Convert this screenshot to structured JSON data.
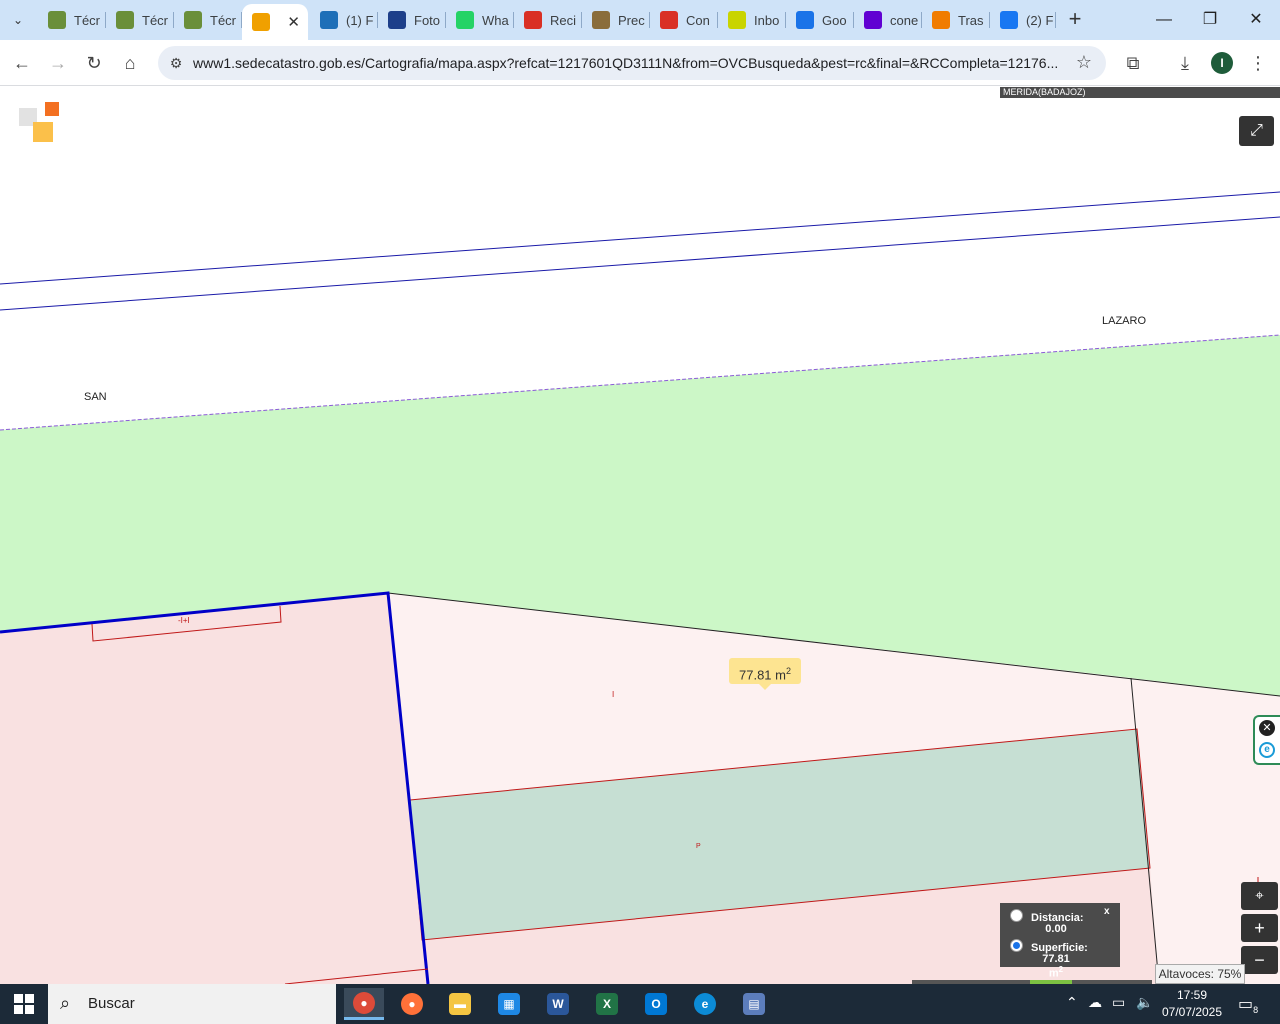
{
  "browser": {
    "tabs": [
      {
        "label": "Técr",
        "icon": "catastro-tab-icon",
        "color": "#6a8f3a"
      },
      {
        "label": "Técr",
        "icon": "catastro-tab-icon",
        "color": "#6a8f3a"
      },
      {
        "label": "Técr",
        "icon": "catastro-tab-icon",
        "color": "#6a8f3a"
      },
      {
        "label": "",
        "icon": "sede-catastro-icon",
        "color": "#f0a000",
        "active": true
      },
      {
        "label": "(1) F",
        "icon": "bluesky-icon",
        "color": "#1e6fb8"
      },
      {
        "label": "Foto",
        "icon": "pro-icon",
        "color": "#1d3f8a"
      },
      {
        "label": "Wha",
        "icon": "whatsapp-icon",
        "color": "#25d366"
      },
      {
        "label": "Reci",
        "icon": "gmail-icon",
        "color": "#d93025"
      },
      {
        "label": "Prec",
        "icon": "document-icon",
        "color": "#8a6d3b"
      },
      {
        "label": "Con",
        "icon": "gmail-icon",
        "color": "#d93025"
      },
      {
        "label": "Inbo",
        "icon": "idealista-icon",
        "color": "#c9d400"
      },
      {
        "label": "Goo",
        "icon": "google-calendar-icon",
        "color": "#1a73e8"
      },
      {
        "label": "cone",
        "icon": "yahoo-icon",
        "color": "#6001d2"
      },
      {
        "label": "Tras",
        "icon": "rtve-icon",
        "color": "#f07c00"
      },
      {
        "label": "(2) F",
        "icon": "facebook-icon",
        "color": "#1877f2"
      }
    ],
    "url": "www1.sedecatastro.gob.es/Cartografia/mapa.aspx?refcat=1217601QD3111N&from=OVCBusqueda&pest=rc&final=&RCCompleta=12176...",
    "profile_initial": "I"
  },
  "map": {
    "municipality": "MERIDA(BADAJOZ)",
    "street_labels": [
      "SAN",
      "LAZARO"
    ],
    "parcel_marker": "-I+I",
    "small_labels": [
      "I",
      "P"
    ],
    "area_tooltip": {
      "value": "77.81 m",
      "unit_exp": "2"
    },
    "measure": {
      "distance_label": "Distancia:",
      "distance_value": "0.00",
      "surface_label": "Superficie:",
      "surface_value": "77.81 m",
      "surface_exp": "2",
      "selected": "surface",
      "close": "x"
    },
    "volume_tooltip": "Altavoces: 75%",
    "colors": {
      "street_fill": "#ffffff",
      "green_zone": "#ccf7c7",
      "parcel_light": "#fdf1f1",
      "parcel_pink": "#f9e1e1",
      "selected_area": "#c6dfd3",
      "parcel_border_blue": "#0000c8",
      "street_line_purple": "#8a5ad6",
      "subparcel_red": "#c01818"
    }
  },
  "taskbar": {
    "search_placeholder": "Buscar",
    "apps": [
      "chrome-icon",
      "firefox-icon",
      "file-explorer-icon",
      "store-icon",
      "word-icon",
      "excel-icon",
      "outlook-icon",
      "edge-icon",
      "calculator-icon"
    ],
    "time": "17:59",
    "date": "07/07/2025",
    "notification_count": "8"
  }
}
